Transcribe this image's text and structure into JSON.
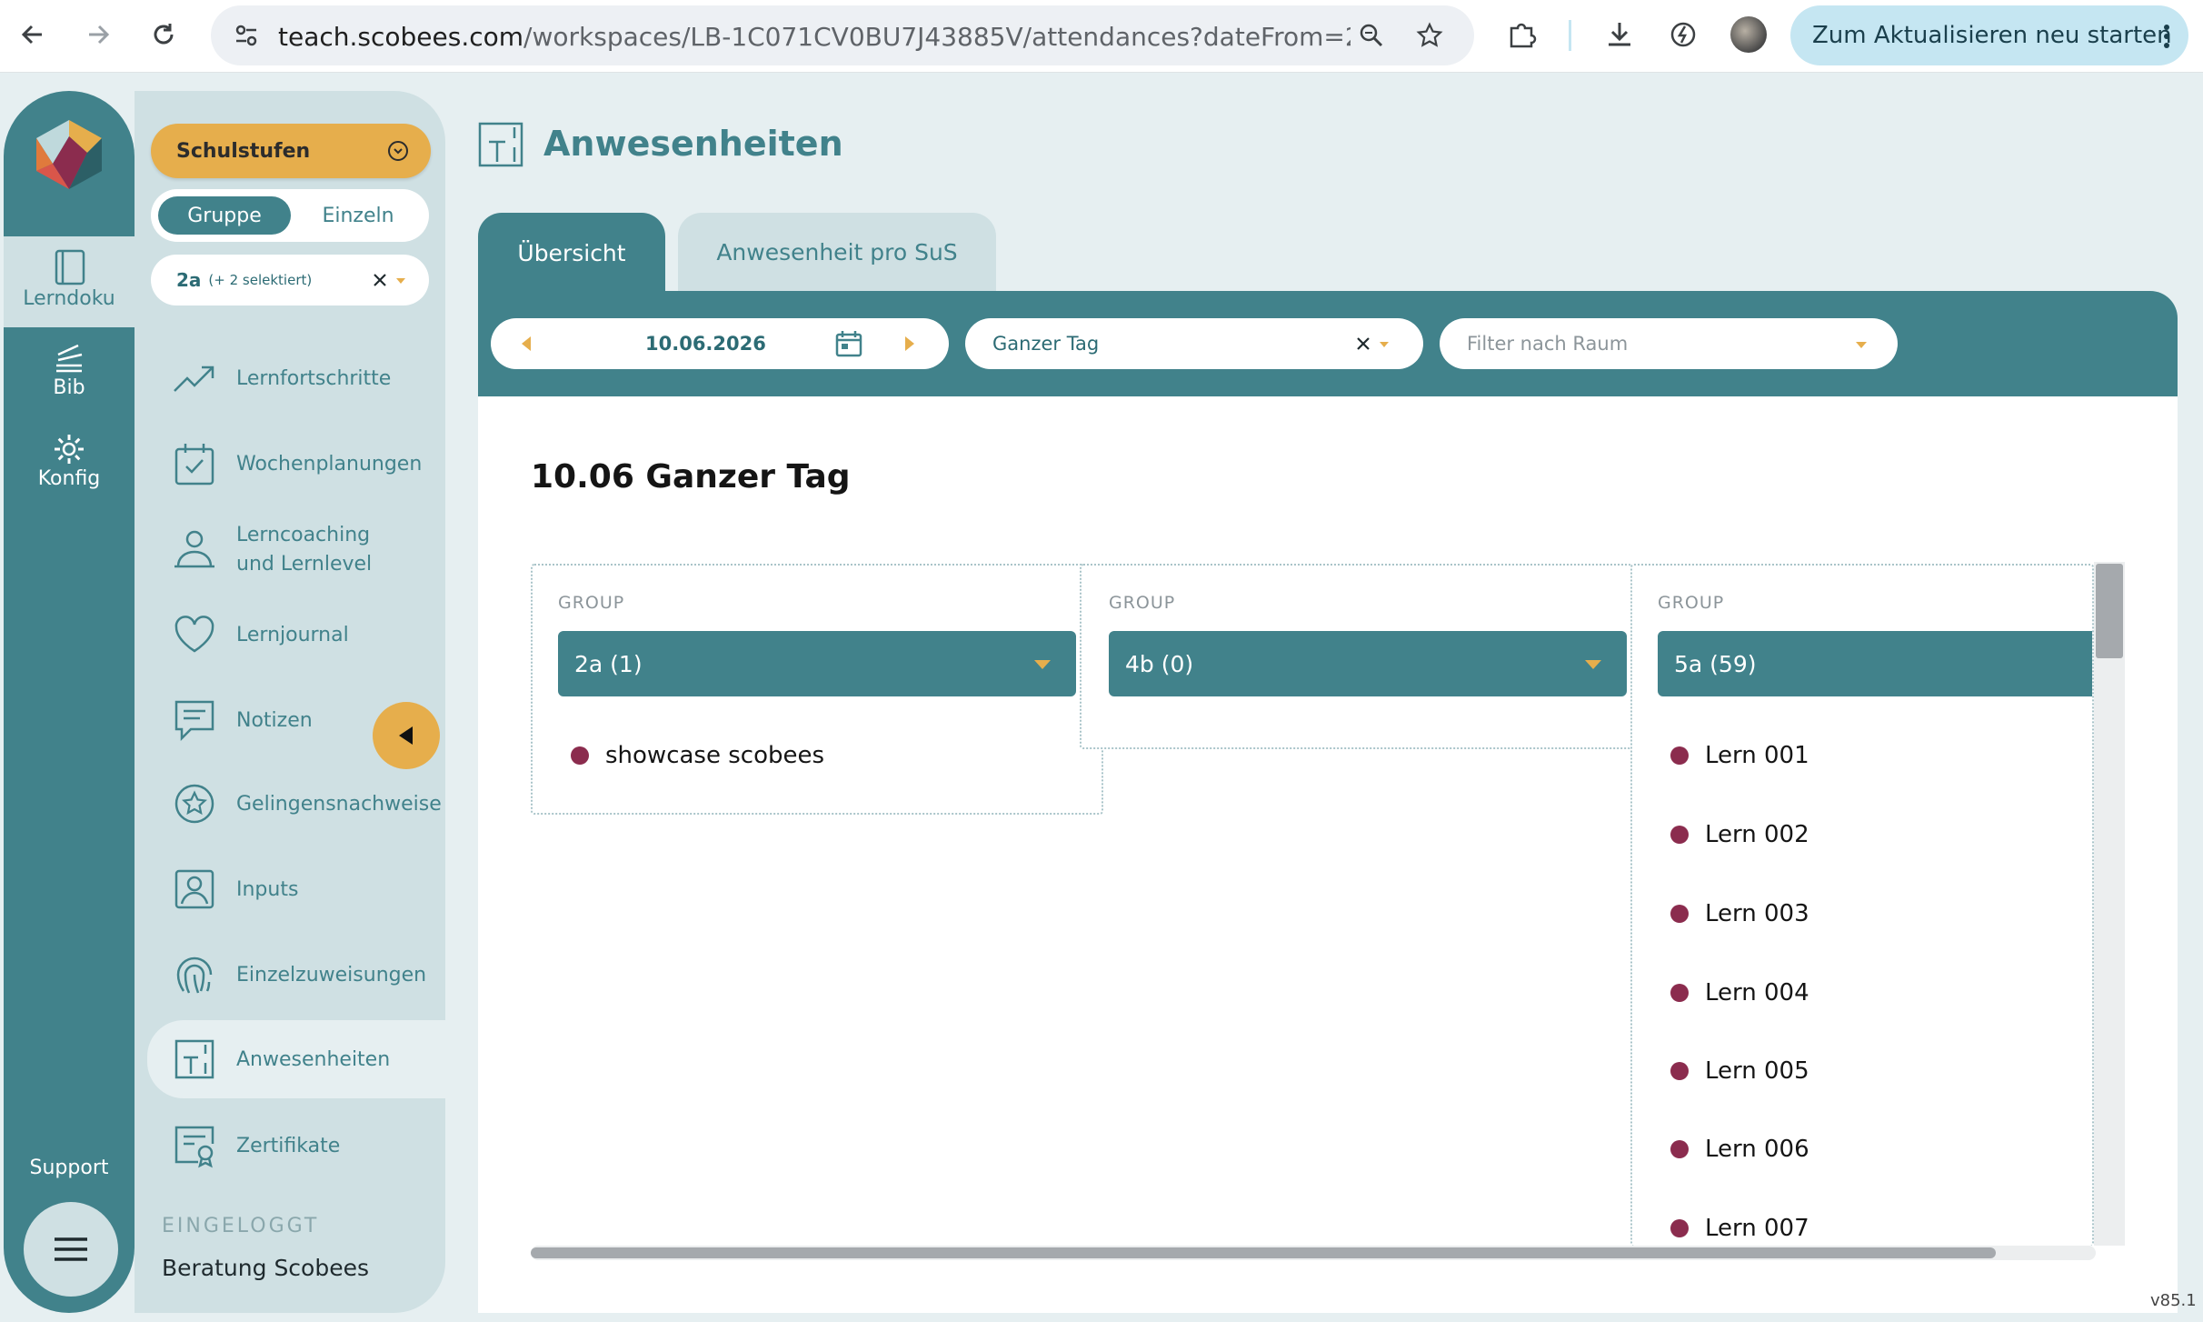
{
  "browser": {
    "url_host": "teach.scobees.com",
    "url_rest": "/workspaces/LB-1C071CV0BU7J43885V/attendances?dateFrom=2...",
    "update_button": "Zum Aktualisieren neu starten"
  },
  "rail": {
    "items": [
      {
        "label": "Lerndoku",
        "icon": "notebook-icon"
      },
      {
        "label": "Bib",
        "icon": "books-icon"
      },
      {
        "label": "Konfig",
        "icon": "gear-icon"
      }
    ],
    "support": "Support"
  },
  "sidebar": {
    "schulstufen": "Schulstufen",
    "toggle": {
      "group": "Gruppe",
      "single": "Einzeln"
    },
    "group_chip": {
      "value": "2a",
      "extra": "(+ 2 selektiert)"
    },
    "items": [
      {
        "label": "Lernfortschritte",
        "icon": "trend-up-icon"
      },
      {
        "label": "Wochenplanungen",
        "icon": "calendar-check-icon"
      },
      {
        "label": "Lerncoaching",
        "label2": "und Lernlevel",
        "icon": "person-icon"
      },
      {
        "label": "Lernjournal",
        "icon": "heart-icon"
      },
      {
        "label": "Notizen",
        "icon": "note-icon"
      },
      {
        "label": "Gelingensnachweise",
        "icon": "star-badge-icon"
      },
      {
        "label": "Inputs",
        "icon": "portrait-icon"
      },
      {
        "label": "Einzelzuweisungen",
        "icon": "fingerprint-icon"
      },
      {
        "label": "Anwesenheiten",
        "icon": "door-icon"
      },
      {
        "label": "Zertifikate",
        "icon": "certificate-icon"
      }
    ],
    "logged_in_label": "EINGELOGGT",
    "logged_in_name": "Beratung Scobees"
  },
  "page": {
    "title": "Anwesenheiten",
    "tabs": [
      {
        "label": "Übersicht",
        "active": true
      },
      {
        "label": "Anwesenheit pro SuS",
        "active": false
      }
    ],
    "date": "10.06.2026",
    "timeslot": "Ganzer Tag",
    "room_filter_placeholder": "Filter nach Raum",
    "card_title": "10.06 Ganzer Tag",
    "version": "v85.1"
  },
  "groups": [
    {
      "label": "GROUP",
      "name": "2a (1)",
      "members": [
        "showcase scobees"
      ]
    },
    {
      "label": "GROUP",
      "name": "4b (0)",
      "members": []
    },
    {
      "label": "GROUP",
      "name": "5a (59)",
      "members": [
        "Lern 001",
        "Lern 002",
        "Lern 003",
        "Lern 004",
        "Lern 005",
        "Lern 006",
        "Lern 007"
      ]
    }
  ],
  "colors": {
    "teal": "#41828b",
    "accent": "#e6ae4c",
    "present_dot": "#8b2c4e"
  }
}
